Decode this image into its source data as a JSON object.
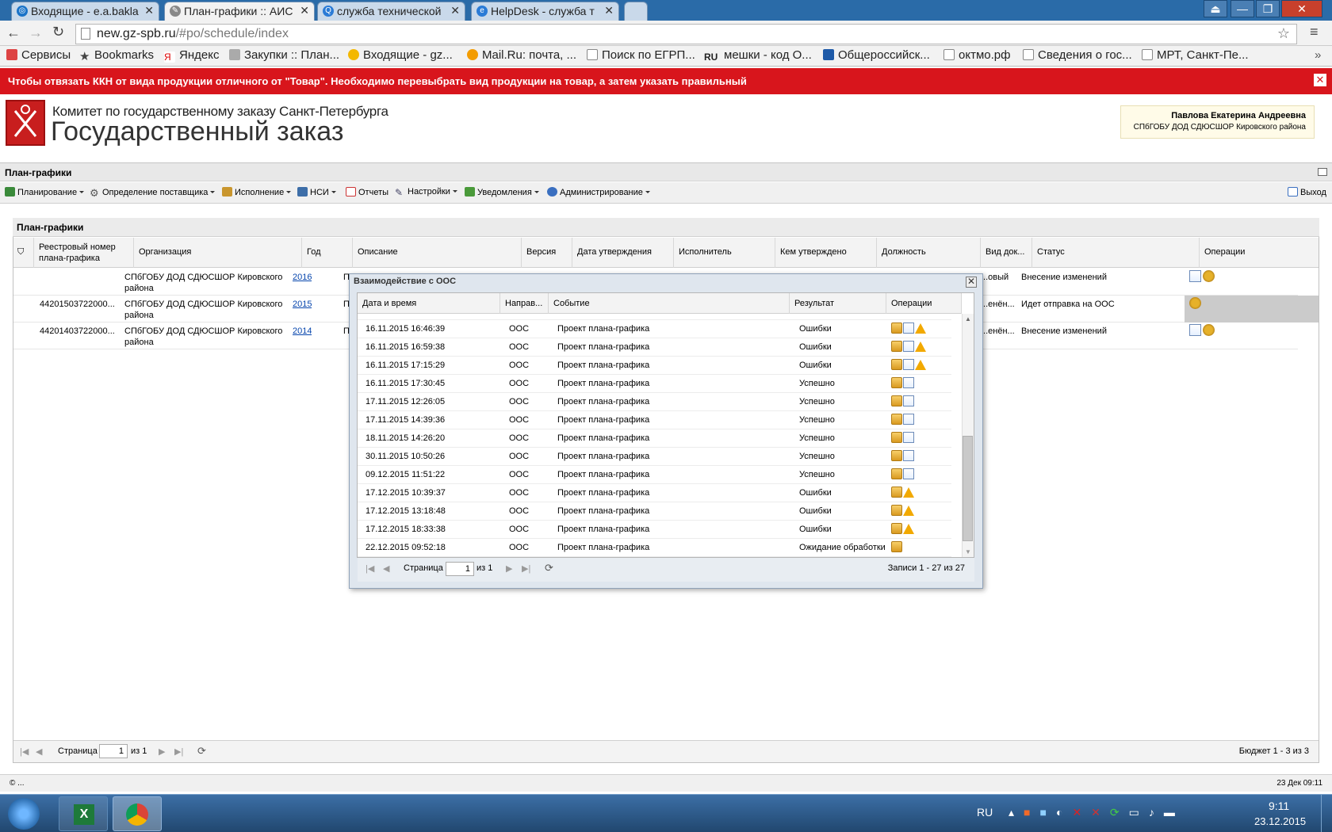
{
  "browser": {
    "tabs": [
      {
        "label": "Входящие - e.a.bakla",
        "icon": "mail-icon",
        "color": "#1a73c8"
      },
      {
        "label": "План-графики :: АИС",
        "icon": "tools-icon",
        "color": "#b0b0b0"
      },
      {
        "label": "служба технической",
        "icon": "search-icon",
        "color": "#2a7bd6"
      },
      {
        "label": "HelpDesk - служба т",
        "icon": "globe-icon",
        "color": "#2a7bd6"
      }
    ],
    "url_host": "new.gz-spb.ru",
    "url_path": "/#po/schedule/index",
    "bookmarks": [
      "Сервисы",
      "Bookmarks",
      "Яндекс",
      "Закупки :: План...",
      "Входящие - gz...",
      "Mail.Ru: почта, ...",
      "Поиск по ЕГРП...",
      "мешки - код О...",
      "Общероссийск...",
      "октмо.рф",
      "Сведения о гос...",
      "МРТ, Санкт-Пе..."
    ]
  },
  "alert": {
    "text": "Чтобы отвязать ККН от вида продукции отличного от \"Товар\". Необходимо перевыбрать вид продукции на товар, а затем указать правильный",
    "color": "#d8151c"
  },
  "header": {
    "committee": "Комитет по государственному заказу Санкт-Петербурга",
    "title": "Государственный заказ",
    "user_name": "Павлова Екатерина Андреевна",
    "user_org": "СПбГОБУ ДОД СДЮСШОР Кировского района"
  },
  "panel_title": "План-графики",
  "menu": [
    {
      "label": "Планирование",
      "icon": "planning-icon"
    },
    {
      "label": "Определение поставщика",
      "icon": "gear-icon"
    },
    {
      "label": "Исполнение",
      "icon": "execution-icon"
    },
    {
      "label": "НСИ",
      "icon": "book-icon"
    },
    {
      "label": "Отчеты",
      "icon": "report-icon"
    },
    {
      "label": "Настройки",
      "icon": "wrench-icon"
    },
    {
      "label": "Уведомления",
      "icon": "notification-icon"
    },
    {
      "label": "Администрирование",
      "icon": "user-icon"
    }
  ],
  "logout": "Выход",
  "grid": {
    "title": "План-графики",
    "columns": [
      "Реестровый номер плана-графика",
      "Организация",
      "Год",
      "Описание",
      "Версия",
      "Дата утверждения",
      "Исполнитель",
      "Кем утверждено",
      "Должность",
      "Вид док...",
      "Статус",
      "Операции"
    ],
    "rows": [
      {
        "reg": "",
        "org": "СПбГОБУ ДОД СДЮСШОР Кировского района",
        "year": "2016",
        "desc": "П",
        "doc": "...овый",
        "status": "Внесение изменений"
      },
      {
        "reg": "44201503722000...",
        "org": "СПбГОБУ ДОД СДЮСШОР Кировского района",
        "year": "2015",
        "desc": "П",
        "doc": "...енён...",
        "status": "Идет отправка на ООС"
      },
      {
        "reg": "44201403722000...",
        "org": "СПбГОБУ ДОД СДЮСШОР Кировского района",
        "year": "2014",
        "desc": "П",
        "doc": "...енён...",
        "status": "Внесение изменений"
      }
    ],
    "pager": {
      "page_label": "Страница",
      "page": "1",
      "of": "из 1",
      "summary": "Бюджет 1 - 3 из 3"
    }
  },
  "modal": {
    "title": "Взаимодействие с ООС",
    "columns": [
      "Дата и время",
      "Направ...",
      "Событие",
      "Результат",
      "Операции"
    ],
    "rows": [
      {
        "dt": "16.11.2015 16:46:39",
        "dir": "ООС",
        "event": "Проект плана-графика",
        "result": "Ошибки",
        "ops": [
          "box",
          "doc",
          "warn"
        ]
      },
      {
        "dt": "16.11.2015 16:59:38",
        "dir": "ООС",
        "event": "Проект плана-графика",
        "result": "Ошибки",
        "ops": [
          "box",
          "doc",
          "warn"
        ]
      },
      {
        "dt": "16.11.2015 17:15:29",
        "dir": "ООС",
        "event": "Проект плана-графика",
        "result": "Ошибки",
        "ops": [
          "box",
          "doc",
          "warn"
        ]
      },
      {
        "dt": "16.11.2015 17:30:45",
        "dir": "ООС",
        "event": "Проект плана-графика",
        "result": "Успешно",
        "ops": [
          "box",
          "doc"
        ]
      },
      {
        "dt": "17.11.2015 12:26:05",
        "dir": "ООС",
        "event": "Проект плана-графика",
        "result": "Успешно",
        "ops": [
          "box",
          "doc"
        ]
      },
      {
        "dt": "17.11.2015 14:39:36",
        "dir": "ООС",
        "event": "Проект плана-графика",
        "result": "Успешно",
        "ops": [
          "box",
          "doc"
        ]
      },
      {
        "dt": "18.11.2015 14:26:20",
        "dir": "ООС",
        "event": "Проект плана-графика",
        "result": "Успешно",
        "ops": [
          "box",
          "doc"
        ]
      },
      {
        "dt": "30.11.2015 10:50:26",
        "dir": "ООС",
        "event": "Проект плана-графика",
        "result": "Успешно",
        "ops": [
          "box",
          "doc"
        ]
      },
      {
        "dt": "09.12.2015 11:51:22",
        "dir": "ООС",
        "event": "Проект плана-графика",
        "result": "Успешно",
        "ops": [
          "box",
          "doc"
        ]
      },
      {
        "dt": "17.12.2015 10:39:37",
        "dir": "ООС",
        "event": "Проект плана-графика",
        "result": "Ошибки",
        "ops": [
          "box",
          "warn"
        ]
      },
      {
        "dt": "17.12.2015 13:18:48",
        "dir": "ООС",
        "event": "Проект плана-графика",
        "result": "Ошибки",
        "ops": [
          "box",
          "warn"
        ]
      },
      {
        "dt": "17.12.2015 18:33:38",
        "dir": "ООС",
        "event": "Проект плана-графика",
        "result": "Ошибки",
        "ops": [
          "box",
          "warn"
        ]
      },
      {
        "dt": "22.12.2015 09:52:18",
        "dir": "ООС",
        "event": "Проект плана-графика",
        "result": "Ожидание обработки",
        "ops": [
          "box"
        ]
      }
    ],
    "pager": {
      "page_label": "Страница",
      "page": "1",
      "of": "из 1",
      "summary": "Записи 1 - 27 из 27"
    }
  },
  "statusbar": {
    "left": "© ...",
    "right": "23 Дек 09:11"
  },
  "taskbar": {
    "lang": "RU",
    "time": "9:11",
    "date": "23.12.2015"
  }
}
